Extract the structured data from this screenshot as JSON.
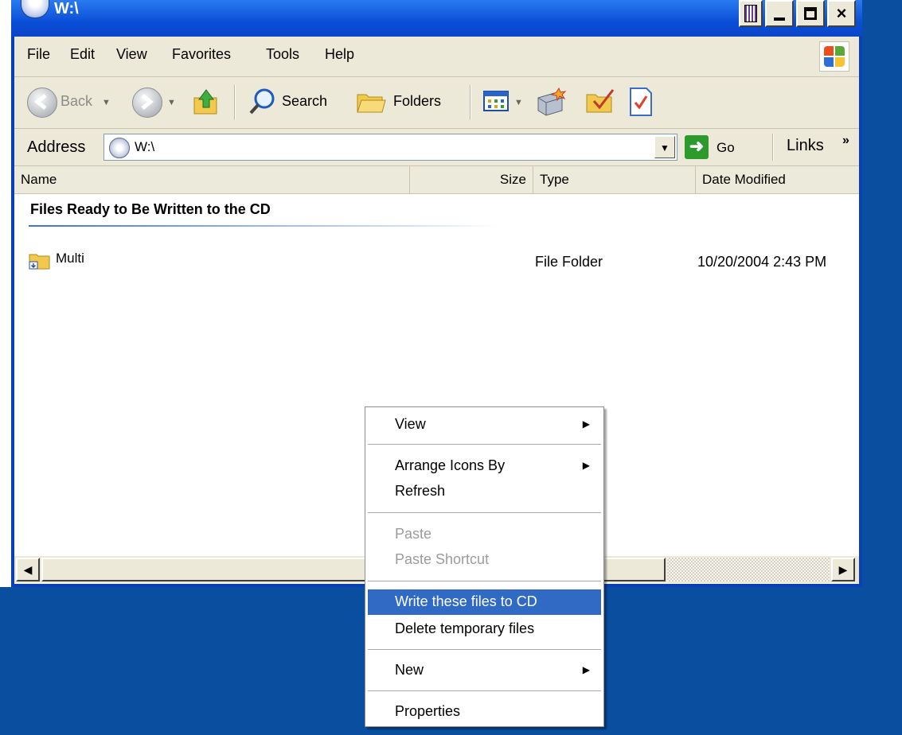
{
  "window": {
    "title": "W:\\",
    "buttons": {
      "minimize": "-",
      "close": "×"
    }
  },
  "menubar": {
    "items": [
      "File",
      "Edit",
      "View",
      "Favorites",
      "Tools",
      "Help"
    ]
  },
  "toolbar": {
    "back": "Back",
    "search": "Search",
    "folders": "Folders"
  },
  "address": {
    "label": "Address",
    "value": "W:\\",
    "go": "Go",
    "links": "Links",
    "links_chevron": "»"
  },
  "columns": {
    "name": "Name",
    "size": "Size",
    "type": "Type",
    "date": "Date Modified"
  },
  "group": {
    "title": "Files Ready to Be Written to the CD"
  },
  "files": [
    {
      "name": "Multi",
      "size": "",
      "type": "File Folder",
      "date": "10/20/2004 2:43 PM"
    }
  ],
  "context_menu": {
    "items": [
      {
        "label": "View",
        "submenu": true,
        "disabled": false,
        "active": false
      },
      {
        "label": "Arrange Icons By",
        "submenu": true,
        "disabled": false,
        "active": false
      },
      {
        "label": "Refresh",
        "submenu": false,
        "disabled": false,
        "active": false
      },
      {
        "label": "Paste",
        "submenu": false,
        "disabled": true,
        "active": false
      },
      {
        "label": "Paste Shortcut",
        "submenu": false,
        "disabled": true,
        "active": false
      },
      {
        "label": "Write these files to CD",
        "submenu": false,
        "disabled": false,
        "active": true
      },
      {
        "label": "Delete temporary files",
        "submenu": false,
        "disabled": false,
        "active": false
      },
      {
        "label": "New",
        "submenu": true,
        "disabled": false,
        "active": false
      },
      {
        "label": "Properties",
        "submenu": false,
        "disabled": false,
        "active": false
      }
    ]
  },
  "colors": {
    "desktop": "#0a4ea0",
    "titlebar": "#0a4ed8",
    "highlight": "#316ac5",
    "chrome": "#ece9d8"
  }
}
